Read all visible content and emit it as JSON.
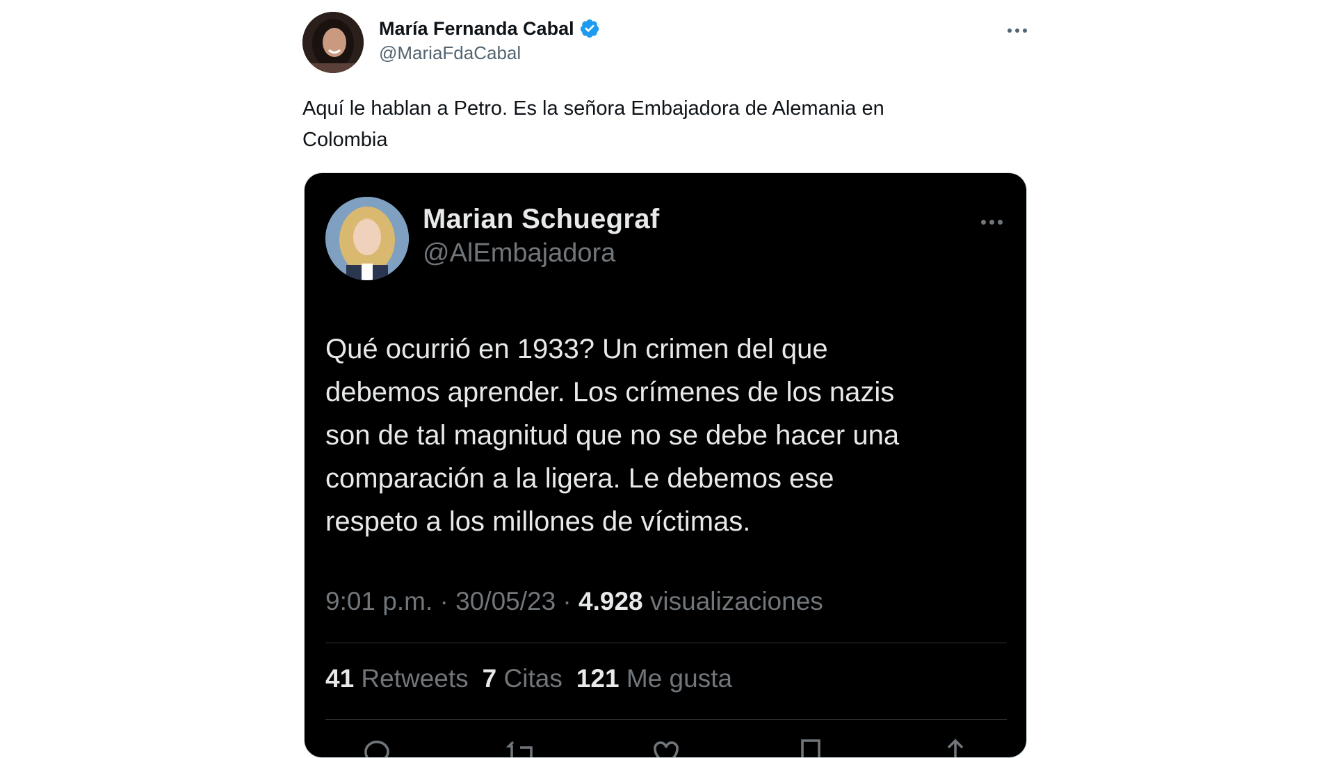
{
  "tweet": {
    "author": {
      "display_name": "María Fernanda Cabal",
      "handle": "@MariaFdaCabal",
      "verified": true,
      "avatar_icon": "user-photo"
    },
    "text_line1": "Aquí le hablan a Petro. Es la señora Embajadora de Alemania en",
    "text_line2": "Colombia",
    "more_icon": "more-horizontal-icon"
  },
  "embedded": {
    "author": {
      "display_name": "Marian Schuegraf",
      "handle": "@AlEmbajadora",
      "avatar_icon": "user-photo"
    },
    "text_lines": [
      "Qué ocurrió en 1933? Un crimen del que",
      "debemos aprender. Los crímenes de los nazis",
      "son de tal magnitud que no se debe hacer una",
      "comparación a la ligera. Le debemos ese",
      "respeto a los millones de víctimas."
    ],
    "meta": {
      "time_date": "9:01 p.m. · 30/05/23 · ",
      "views_count": "4.928",
      "views_label": " visualizaciones"
    },
    "stats": {
      "retweets_count": "41",
      "retweets_label": " Retweets",
      "quotes_count": "7",
      "quotes_label": " Citas",
      "likes_count": "121",
      "likes_label": " Me gusta"
    },
    "actions": [
      "reply-icon",
      "retweet-icon",
      "like-icon",
      "bookmark-icon",
      "share-icon"
    ]
  },
  "colors": {
    "verified": "#1d9bf0",
    "text_dark": "#0f1419",
    "text_muted": "#536471",
    "embedded_bg": "#000000",
    "embedded_text": "#e7e9ea",
    "embedded_muted": "#71767b"
  }
}
